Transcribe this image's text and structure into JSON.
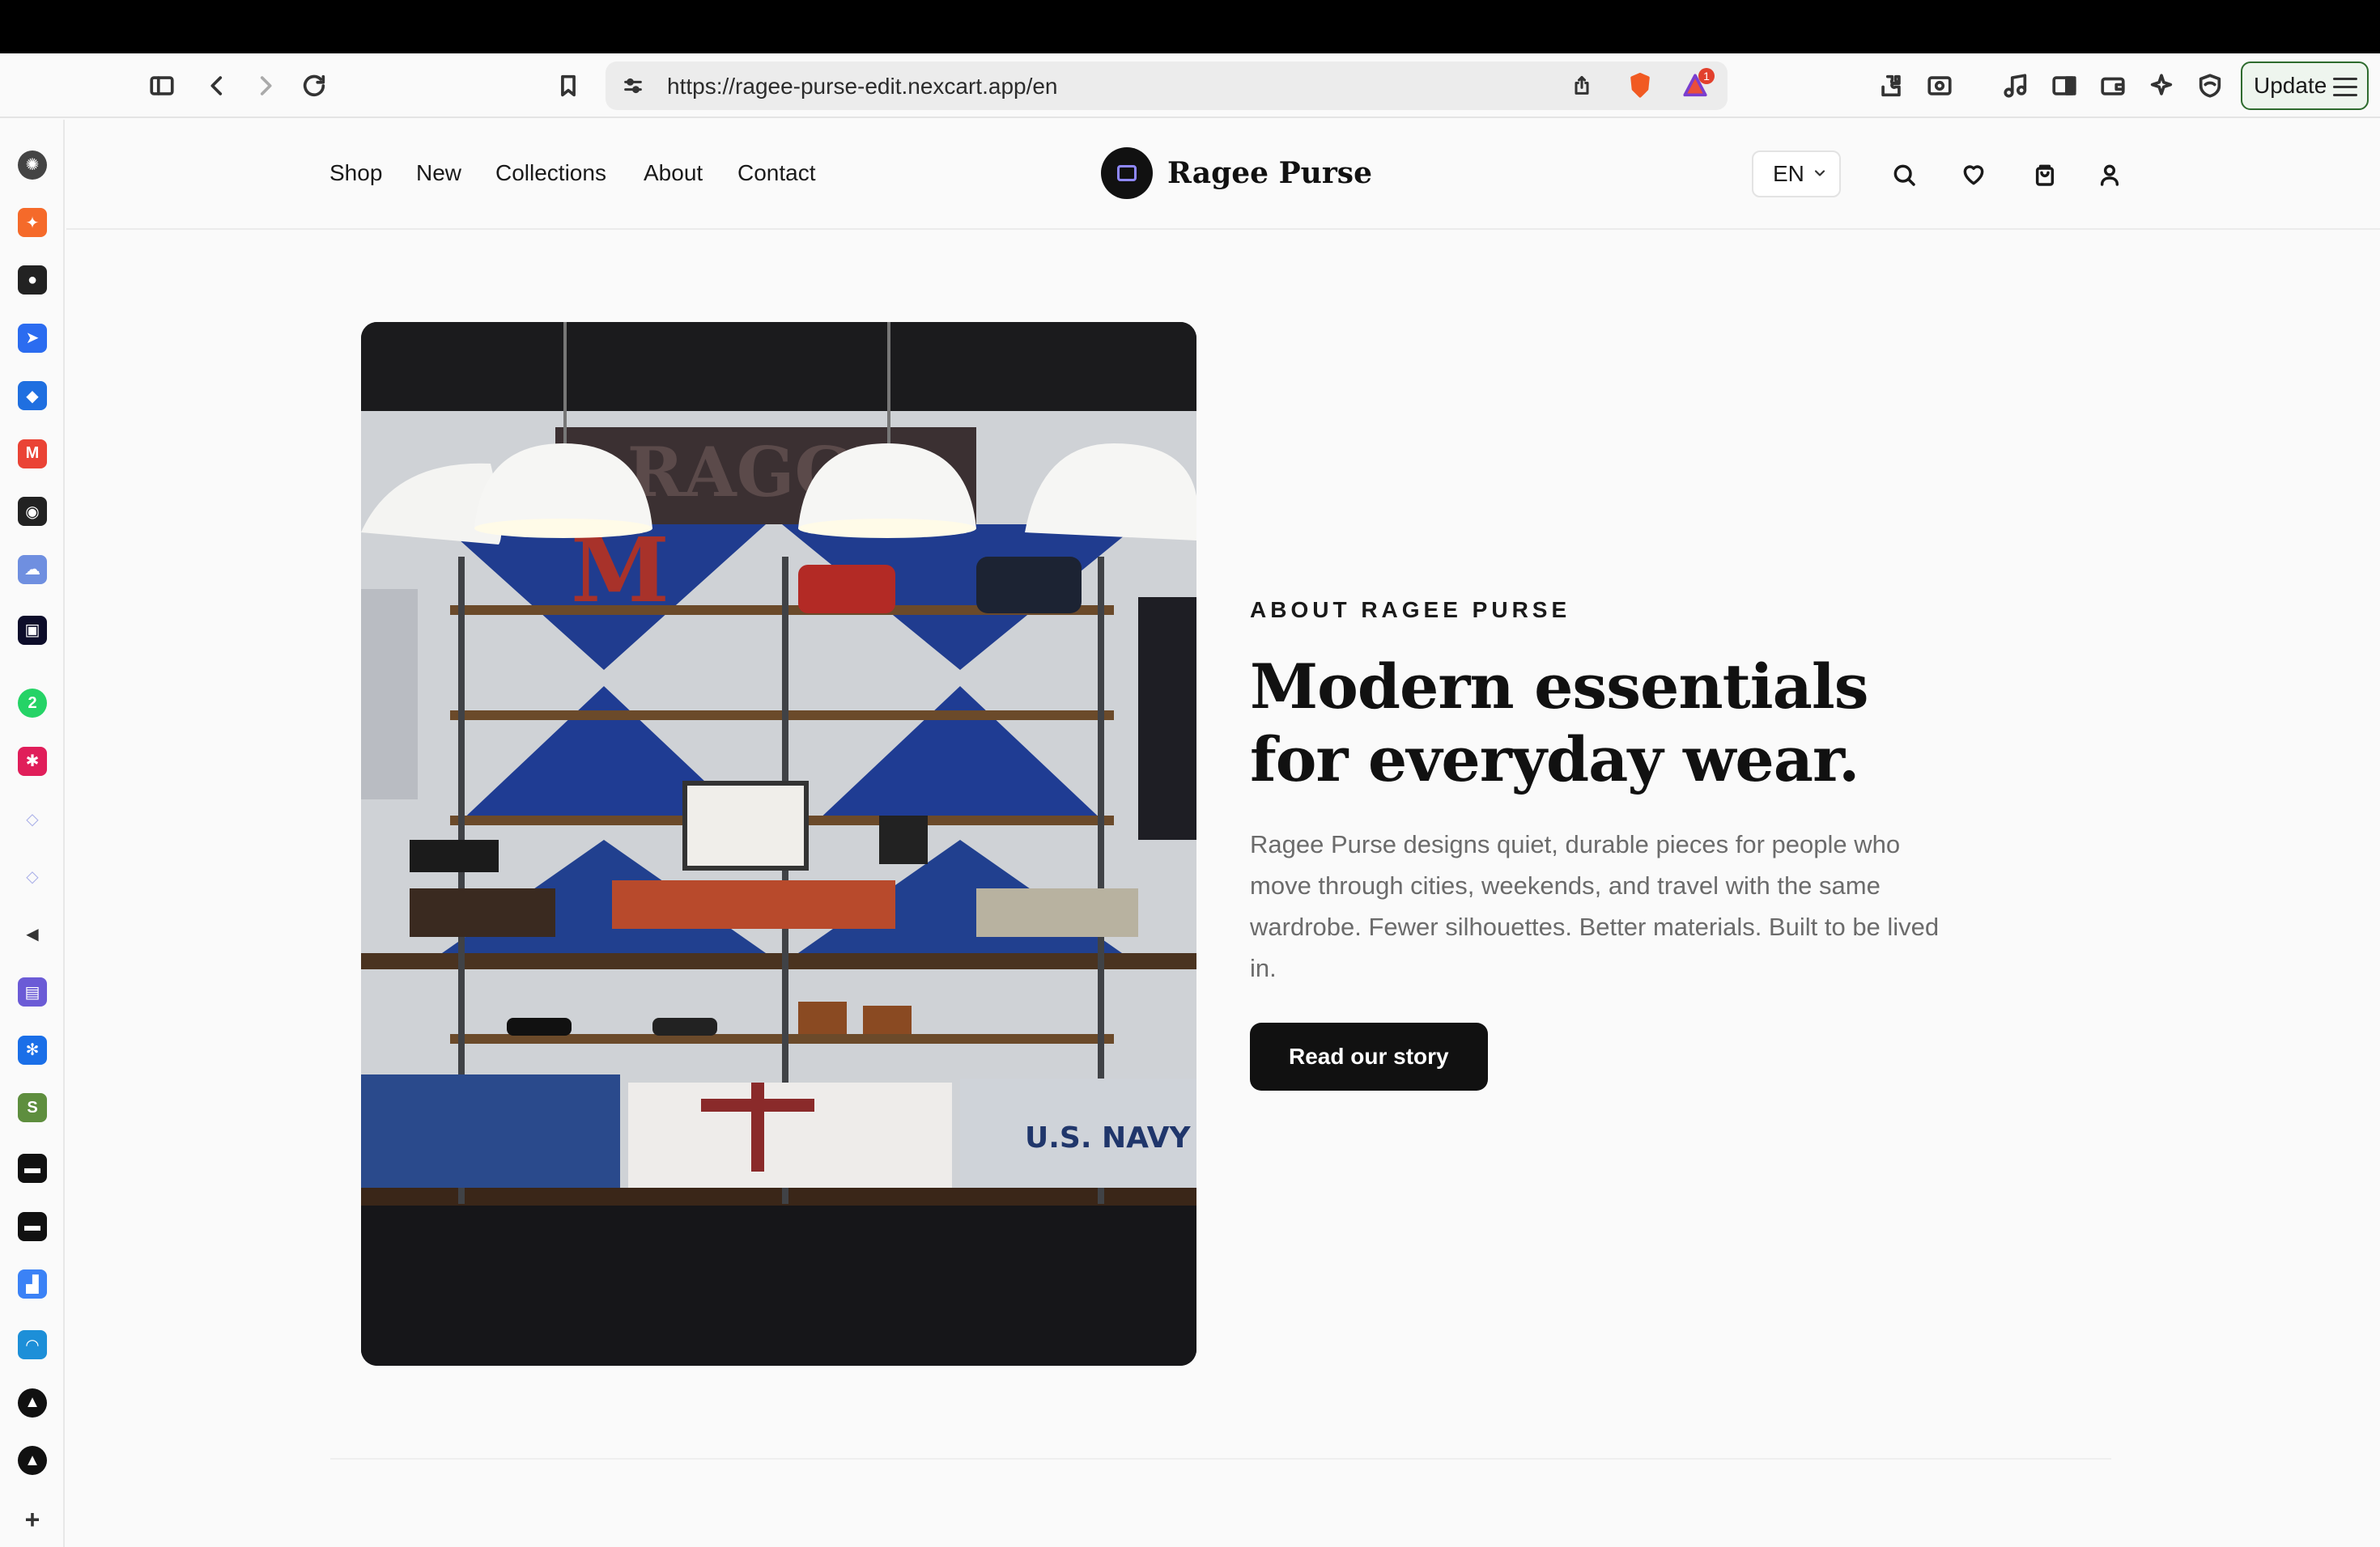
{
  "browser": {
    "url": "https://ragee-purse-edit.nexcart.app/en",
    "update_label": "Update",
    "notification_count": "1"
  },
  "sidebar_apps": [
    "chatgpt-icon",
    "spark-icon",
    "apple-icon",
    "paper-plane-icon",
    "chat-bubble-icon",
    "gmail-icon",
    "github-icon",
    "cloud-icon",
    "monitor-icon",
    "whatsapp-icon",
    "slack-icon",
    "diamond-icon",
    "diamond-icon",
    "speaker-icon",
    "bars-icon",
    "gear-icon",
    "shopify-icon",
    "terminal-icon",
    "terminal-icon",
    "analytics-icon",
    "wave-icon",
    "triangle-icon",
    "triangle-icon"
  ],
  "site": {
    "nav": [
      "Shop",
      "New",
      "Collections",
      "About",
      "Contact"
    ],
    "brand": "Ragee Purse",
    "language": "EN"
  },
  "hero": {
    "eyebrow": "ABOUT RAGEE PURSE",
    "headline": "Modern essentials for everyday wear.",
    "body": "Ragee Purse designs quiet, durable pieces for people who move through cities, weekends, and travel with the same wardrobe. Fewer silhouettes. Better materials. Built to be lived in.",
    "cta": "Read our story",
    "photo_text": {
      "banner": "RAGGE",
      "letter": "M",
      "sweater": "U.S. NAVY"
    }
  }
}
